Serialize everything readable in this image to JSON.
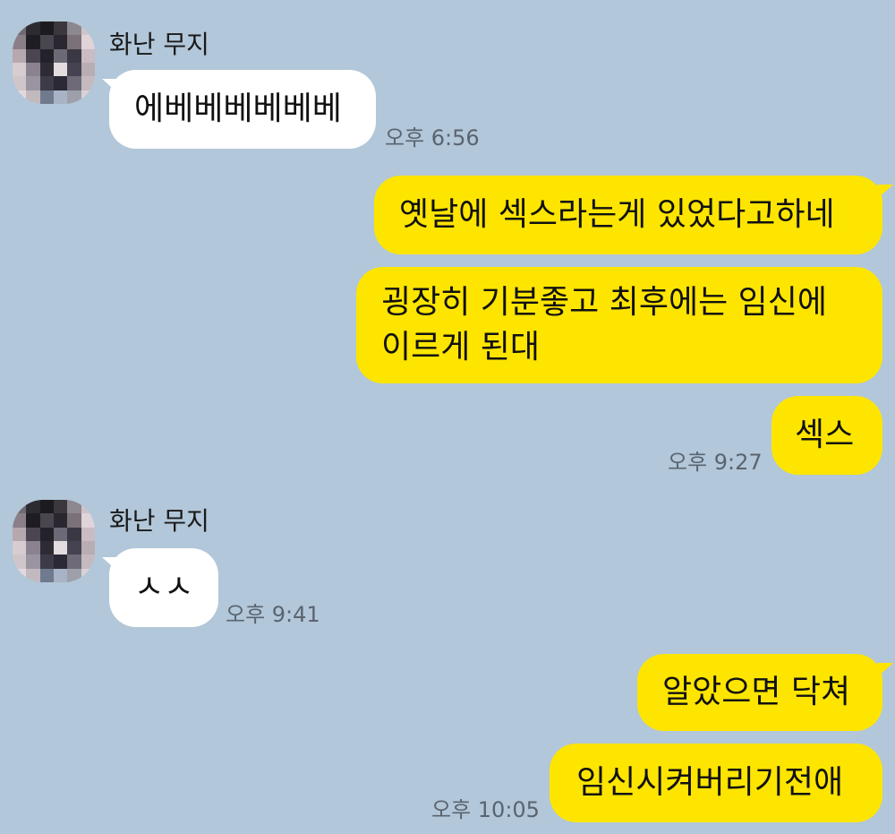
{
  "colors": {
    "background": "#b2c7d9",
    "incoming_bubble": "#ffffff",
    "outgoing_bubble": "#fee500",
    "timestamp": "#5a6470"
  },
  "incoming_1": {
    "sender": "화난 무지",
    "avatar_icon": "pixelated-avatar-icon",
    "message": "에베베베베베베",
    "time": "오후 6:56"
  },
  "outgoing_1": {
    "messages": [
      "옛날에 섹스라는게 있었다고하네",
      "굉장히 기분좋고 최후에는 임신에",
      "이르게 된대",
      "섹스"
    ],
    "time": "오후 9:27"
  },
  "incoming_2": {
    "sender": "화난 무지",
    "avatar_icon": "pixelated-avatar-icon",
    "message": "ㅅㅅ",
    "time": "오후 9:41"
  },
  "outgoing_2": {
    "messages": [
      "알았으면 닥쳐",
      "임신시켜버리기전애"
    ],
    "time": "오후 10:05"
  }
}
